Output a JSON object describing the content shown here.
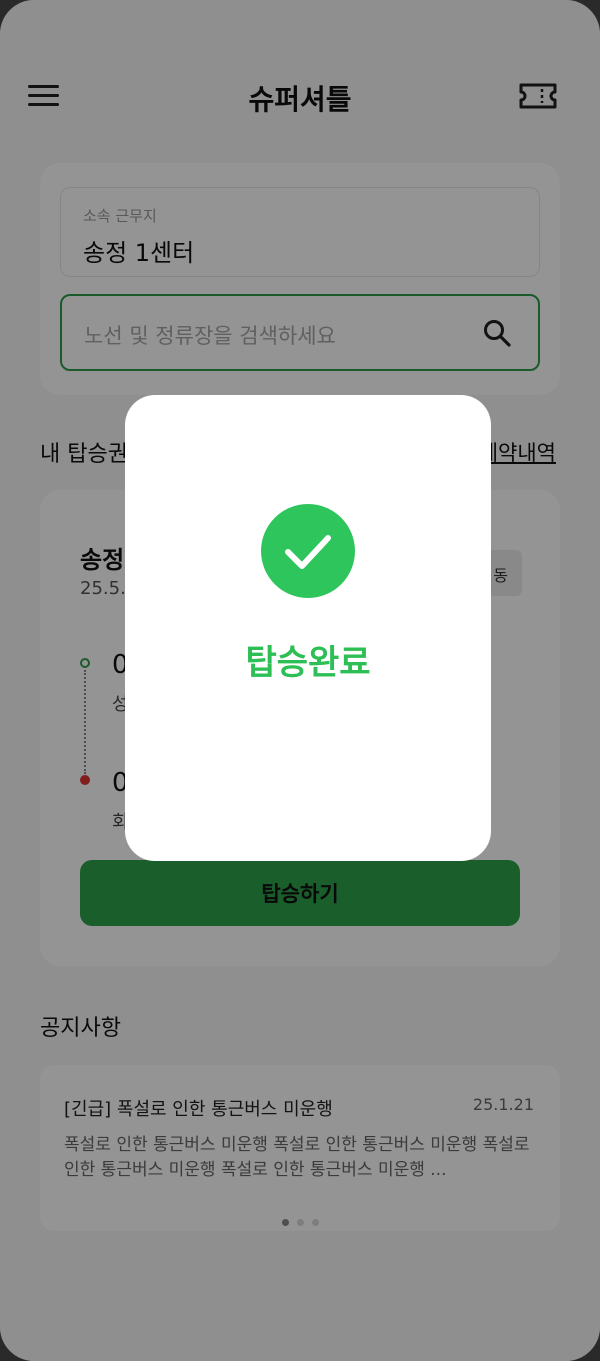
{
  "header": {
    "title": "슈퍼셔틀",
    "menu_icon": "hamburger-menu-icon",
    "ticket_icon": "ticket-icon"
  },
  "workplace": {
    "label": "소속 근무지",
    "value": "송정 1센터"
  },
  "search": {
    "placeholder": "노선 및 정류장을 검색하세요",
    "icon": "search-icon"
  },
  "my_ticket": {
    "section_title": "내 탑승권",
    "link_label": "예약내역",
    "route_name": "송정",
    "date": "25.5.",
    "chip_label": "동",
    "stops": [
      {
        "time": "0",
        "name": "성"
      },
      {
        "time": "0",
        "name": "회"
      }
    ],
    "board_button": "탑승하기"
  },
  "notices": {
    "section_title": "공지사항",
    "items": [
      {
        "title": "[긴급] 폭설로 인한 통근버스 미운행",
        "date": "25.1.21",
        "body": "폭설로 인한 통근버스 미운행 폭설로 인한 통근버스 미운행 폭설로 인한 통근버스 미운행 폭설로 인한 통근버스 미운행 ..."
      }
    ],
    "page_count": 3,
    "active_page": 1
  },
  "modal": {
    "icon": "check-circle-icon",
    "message": "탑승완료"
  },
  "colors": {
    "accent": "#2ca34b",
    "success": "#2dc55c"
  }
}
